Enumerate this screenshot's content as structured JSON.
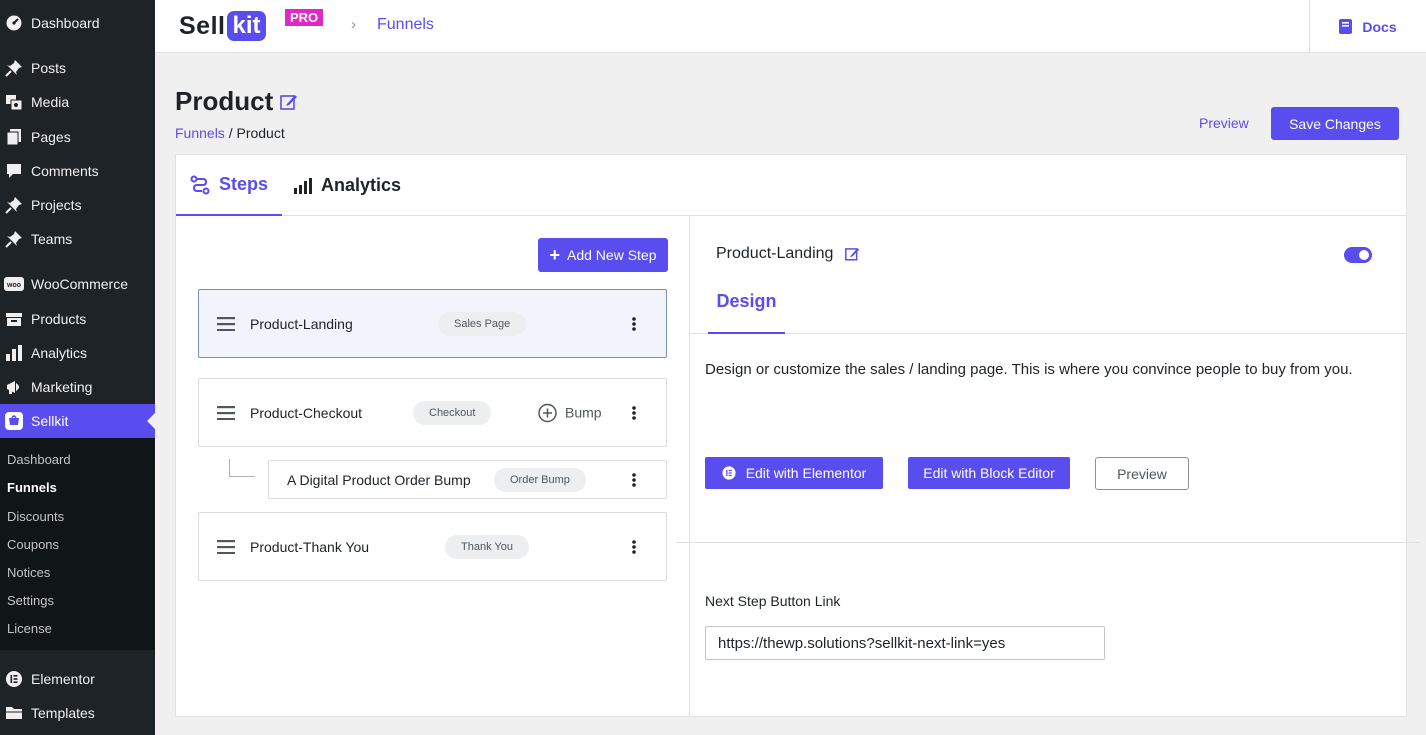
{
  "sidebar": {
    "items": [
      {
        "label": "Dashboard",
        "icon": "dashboard-icon"
      },
      {
        "label": "Posts",
        "icon": "pin-icon"
      },
      {
        "label": "Media",
        "icon": "media-icon"
      },
      {
        "label": "Pages",
        "icon": "pages-icon"
      },
      {
        "label": "Comments",
        "icon": "comment-icon"
      },
      {
        "label": "Projects",
        "icon": "pin-icon"
      },
      {
        "label": "Teams",
        "icon": "pin-icon"
      },
      {
        "label": "WooCommerce",
        "icon": "woo-icon"
      },
      {
        "label": "Products",
        "icon": "archive-icon"
      },
      {
        "label": "Analytics",
        "icon": "bar-chart-icon"
      },
      {
        "label": "Marketing",
        "icon": "megaphone-icon"
      },
      {
        "label": "Sellkit",
        "icon": "sellkit-icon"
      },
      {
        "label": "Elementor",
        "icon": "elementor-icon"
      },
      {
        "label": "Templates",
        "icon": "folder-icon"
      }
    ],
    "submenu": [
      "Dashboard",
      "Funnels",
      "Discounts",
      "Coupons",
      "Notices",
      "Settings",
      "License"
    ],
    "active_item": "Sellkit",
    "current_submenu": "Funnels"
  },
  "topbar": {
    "logo_sell": "Sell",
    "logo_kit": "kit",
    "logo_pro": "PRO",
    "breadcrumb": "Funnels",
    "docs_label": "Docs"
  },
  "header": {
    "title": "Product",
    "breadcrumb_link": "Funnels",
    "breadcrumb_sep": "/",
    "breadcrumb_current": "Product",
    "preview_label": "Preview",
    "save_label": "Save Changes"
  },
  "tabs": {
    "steps": "Steps",
    "analytics": "Analytics"
  },
  "steps_panel": {
    "add_label": "Add New Step",
    "steps": [
      {
        "name": "Product-Landing",
        "badge": "Sales Page"
      },
      {
        "name": "Product-Checkout",
        "badge": "Checkout",
        "bump_label": "Bump"
      },
      {
        "name": "A Digital Product Order Bump",
        "badge": "Order Bump"
      },
      {
        "name": "Product-Thank You",
        "badge": "Thank You"
      }
    ]
  },
  "detail_panel": {
    "step_title": "Product-Landing",
    "design_tab": "Design",
    "description": "Design or customize the sales / landing page. This is where you convince people to buy from you.",
    "edit_elementor_label": "Edit with Elementor",
    "edit_block_label": "Edit with Block Editor",
    "preview_label": "Preview",
    "next_link_label": "Next Step Button Link",
    "next_link_value": "https://thewp.solutions?sellkit-next-link=yes",
    "enabled": true
  },
  "colors": {
    "accent": "#5a4df0",
    "sidebar_bg": "#1d2327",
    "pro_badge": "#e028c8"
  }
}
